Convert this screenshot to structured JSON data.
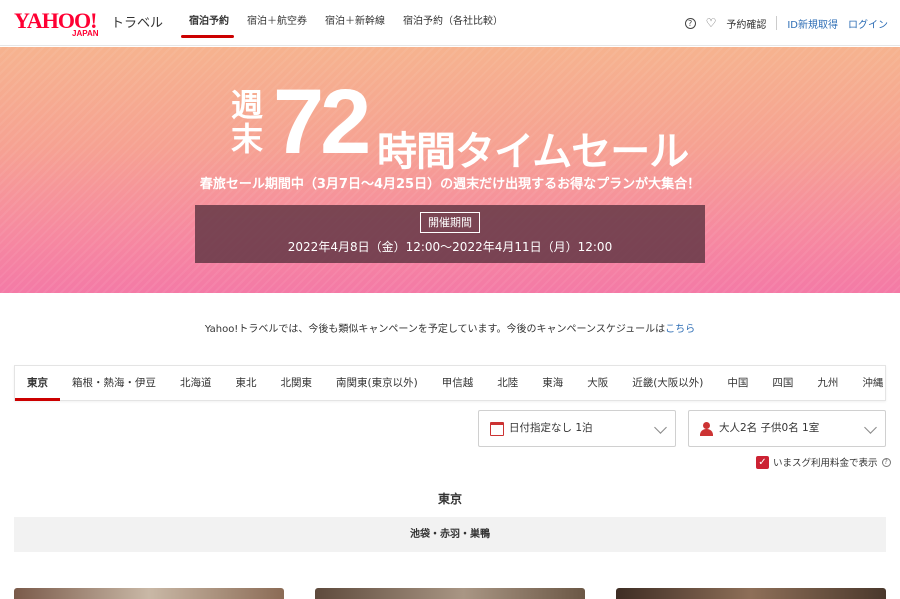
{
  "header": {
    "logo_yahoo": "YAHOO!",
    "logo_japan": "JAPAN",
    "logo_service": "トラベル",
    "nav": [
      {
        "label": "宿泊予約",
        "active": true
      },
      {
        "label": "宿泊＋航空券",
        "active": false
      },
      {
        "label": "宿泊＋新幹線",
        "active": false
      },
      {
        "label": "宿泊予約（各社比較）",
        "active": false
      }
    ],
    "help_icon": "?",
    "reservation_check": "予約確認",
    "register": "ID新規取得",
    "login": "ログイン"
  },
  "banner": {
    "title_weekend": "週末",
    "title_number": "72",
    "title_rest": "時間タイムセール",
    "subtitle": "春旅セール期間中（3月7日〜4月25日）の週末だけ出現するお得なプランが大集合！",
    "period_label": "開催期間",
    "period_dates": "2022年4月8日（金）12:00〜2022年4月11日（月）12:00"
  },
  "notice": {
    "text": "Yahoo!トラベルでは、今後も類似キャンペーンを予定しています。今後のキャンペーンスケジュールは",
    "link": "こちら"
  },
  "regions": [
    {
      "label": "東京",
      "active": true
    },
    {
      "label": "箱根・熱海・伊豆",
      "active": false
    },
    {
      "label": "北海道",
      "active": false
    },
    {
      "label": "東北",
      "active": false
    },
    {
      "label": "北関東",
      "active": false
    },
    {
      "label": "南関東(東京以外)",
      "active": false
    },
    {
      "label": "甲信越",
      "active": false
    },
    {
      "label": "北陸",
      "active": false
    },
    {
      "label": "東海",
      "active": false
    },
    {
      "label": "大阪",
      "active": false
    },
    {
      "label": "近畿(大阪以外)",
      "active": false
    },
    {
      "label": "中国",
      "active": false
    },
    {
      "label": "四国",
      "active": false
    },
    {
      "label": "九州",
      "active": false
    },
    {
      "label": "沖縄",
      "active": false
    }
  ],
  "search": {
    "date_value": "日付指定なし 1泊",
    "guests_value": "大人2名 子供0名 1室",
    "price_checkbox_label": "いまスグ利用料金で表示",
    "price_checkbox_checked": true
  },
  "section": {
    "title": "東京",
    "area": "池袋・赤羽・巣鴨"
  },
  "colors": {
    "accent": "#cc0000",
    "link": "#2d6db5"
  }
}
